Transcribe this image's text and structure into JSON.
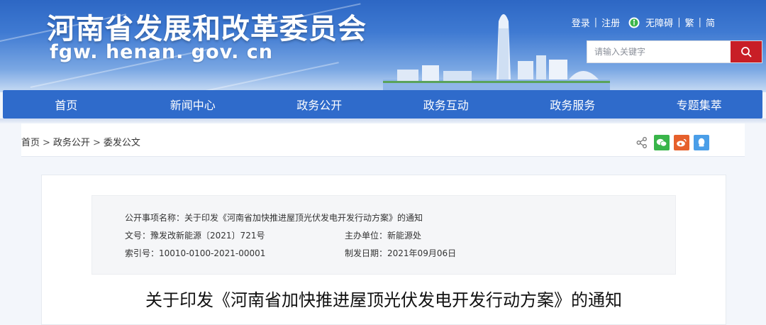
{
  "header": {
    "site_title": "河南省发展和改革委员会",
    "site_domain": "fgw. henan. gov. cn",
    "top_links": {
      "login": "登录",
      "register": "注册",
      "accessibility": "无障碍",
      "traditional": "繁",
      "simplified": "简",
      "sep": "|"
    },
    "search": {
      "placeholder": "请输入关键字"
    }
  },
  "nav": {
    "items": [
      {
        "label": "首页"
      },
      {
        "label": "新闻中心"
      },
      {
        "label": "政务公开"
      },
      {
        "label": "政务互动"
      },
      {
        "label": "政务服务"
      },
      {
        "label": "专题集萃"
      }
    ]
  },
  "breadcrumb": {
    "items": [
      "首页",
      "政务公开",
      "委发公文"
    ],
    "separator": ">"
  },
  "share": {
    "icons": [
      "share-icon",
      "wechat-icon",
      "weibo-icon",
      "qq-icon"
    ],
    "colors": {
      "wechat": "#39b54a",
      "weibo": "#e6602c",
      "qq": "#4a9ee8"
    }
  },
  "article": {
    "meta": {
      "public_item_label": "公开事项名称：",
      "public_item_value": "关于印发《河南省加快推进屋顶光伏发电开发行动方案》的通知",
      "doc_no_label": "文号：",
      "doc_no_value": "豫发改新能源〔2021〕721号",
      "host_label": "主办单位：",
      "host_value": "新能源处",
      "index_label": "索引号：",
      "index_value": "10010-0100-2021-00001",
      "date_label": "制发日期：",
      "date_value": "2021年09月06日"
    },
    "title": "关于印发《河南省加快推进屋顶光伏发电开发行动方案》的通知"
  },
  "colors": {
    "primary_blue": "#2f6bcb",
    "search_red": "#c81e26"
  }
}
